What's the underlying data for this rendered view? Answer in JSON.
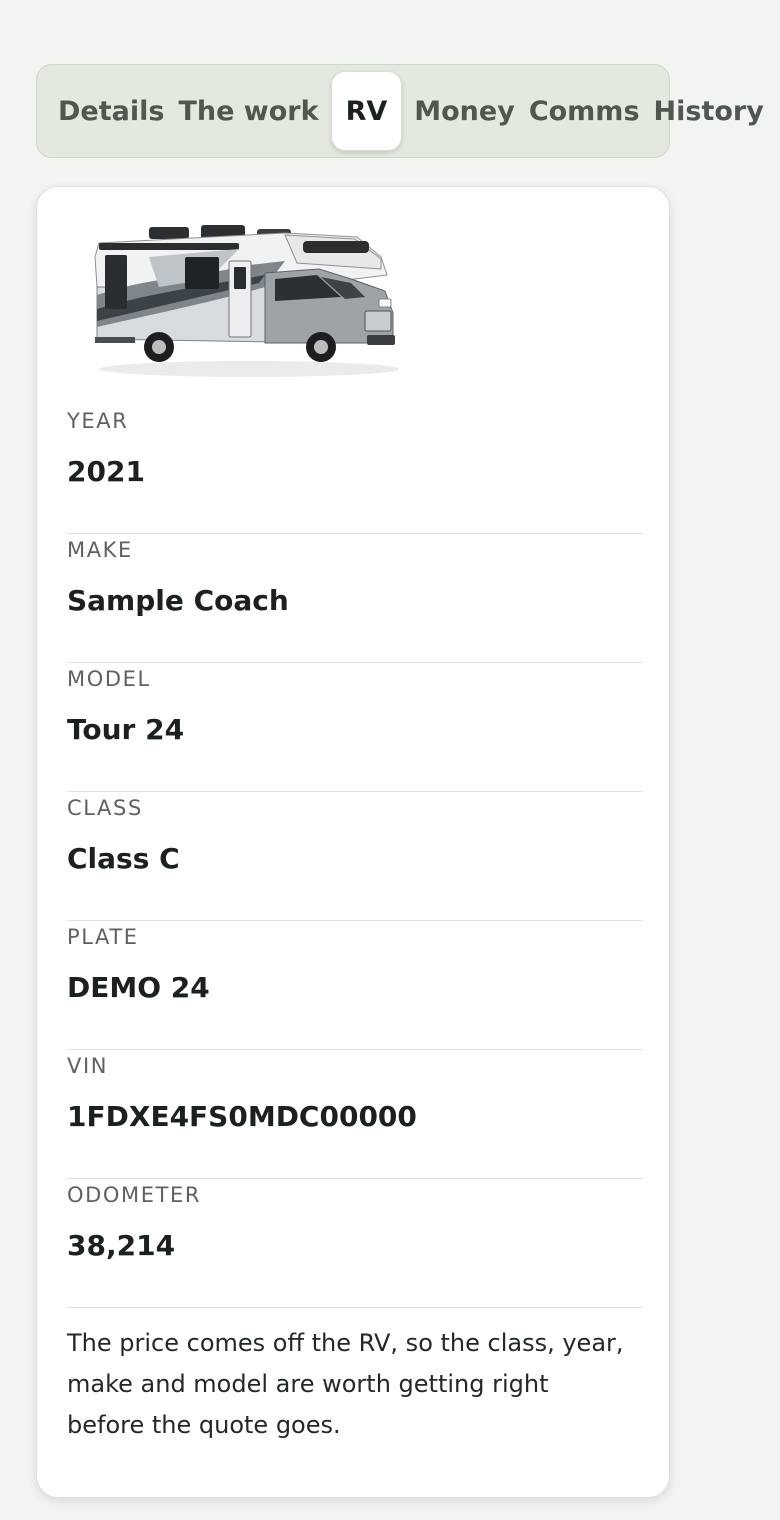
{
  "tabs": [
    {
      "label": "Details"
    },
    {
      "label": "The work"
    },
    {
      "label": "RV"
    },
    {
      "label": "Money"
    },
    {
      "label": "Comms"
    },
    {
      "label": "History"
    }
  ],
  "active_tab": "RV",
  "rv": {
    "photo_icon": "class-c-motorhome-image",
    "fields": [
      {
        "label": "YEAR",
        "value": "2021"
      },
      {
        "label": "MAKE",
        "value": "Sample Coach"
      },
      {
        "label": "MODEL",
        "value": "Tour 24"
      },
      {
        "label": "CLASS",
        "value": "Class C"
      },
      {
        "label": "PLATE",
        "value": "DEMO 24"
      },
      {
        "label": "VIN",
        "value": "1FDXE4FS0MDC00000"
      },
      {
        "label": "ODOMETER",
        "value": "38,214"
      }
    ],
    "note": "The price comes off the RV, so the class, year, make and model are worth getting right before the quote goes."
  },
  "colors": {
    "tab_bar_bg": "#e3e9de",
    "card_bg": "#ffffff",
    "page_bg": "#f2f4f1",
    "label_text": "#5b645c",
    "value_text": "#1b211c"
  }
}
